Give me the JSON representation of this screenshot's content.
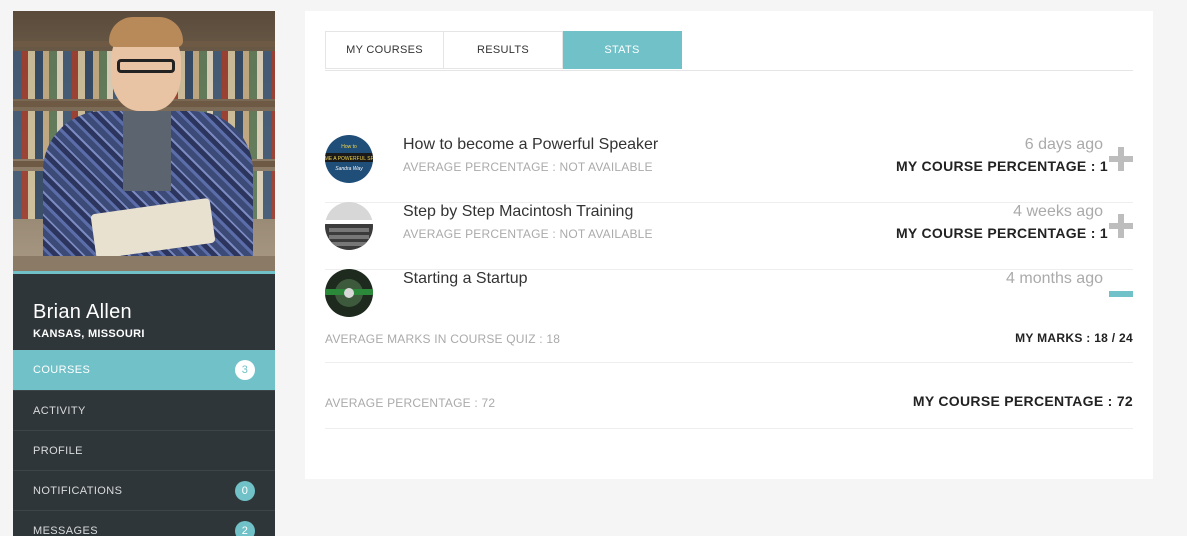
{
  "profile": {
    "name": "Brian Allen",
    "location": "KANSAS, MISSOURI"
  },
  "nav": [
    {
      "label": "COURSES",
      "badge": "3",
      "active": true
    },
    {
      "label": "ACTIVITY",
      "badge": ""
    },
    {
      "label": "PROFILE",
      "badge": ""
    },
    {
      "label": "NOTIFICATIONS",
      "badge": "0"
    },
    {
      "label": "MESSAGES",
      "badge": "2"
    }
  ],
  "tabs": [
    {
      "label": "MY COURSES"
    },
    {
      "label": "RESULTS"
    },
    {
      "label": "STATS",
      "active": true
    }
  ],
  "courses": [
    {
      "title": "How to become a Powerful Speaker",
      "avg": "AVERAGE PERCENTAGE : NOT AVAILABLE",
      "time": "6 days ago",
      "pct": "MY COURSE PERCENTAGE : 1",
      "state": "collapsed",
      "thumb_text": "How to / OME A POWERFUL SPE / Sandra Way"
    },
    {
      "title": "Step by Step Macintosh Training",
      "avg": "AVERAGE PERCENTAGE : NOT AVAILABLE",
      "time": "4 weeks ago",
      "pct": "MY COURSE PERCENTAGE : 1",
      "state": "collapsed"
    },
    {
      "title": "Starting a Startup",
      "time": "4 months ago",
      "state": "expanded"
    }
  ],
  "quiz": {
    "avg": "AVERAGE MARKS IN COURSE QUIZ : 18",
    "marks": "MY MARKS : 18 / 24"
  },
  "totals": {
    "avg": "AVERAGE PERCENTAGE : 72",
    "pct": "MY COURSE PERCENTAGE : 72"
  },
  "colors": {
    "accent": "#70c1c8",
    "sidebar": "#2f3639",
    "page_bg": "#f5f5f5"
  }
}
